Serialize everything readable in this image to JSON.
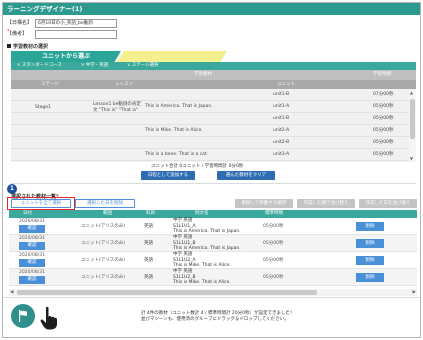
{
  "window": {
    "title": "ラーニングデザイナー(1)"
  },
  "form": {
    "title_label": "【日構名】",
    "title_req": "*",
    "title_value": "6月10日の小_英語_be動詞",
    "memo_label": "【備考】",
    "memo_value": ""
  },
  "section_title": "学習教材の選択",
  "tabs": {
    "active": "ユニットから選ぶ",
    "inactive": ""
  },
  "filters": {
    "course": "∨ スタンダードコース",
    "level": "∨ 中学・英語",
    "stage": "∨ ステージ選択"
  },
  "upper_table": {
    "header_group": "学習教材",
    "header_time": "学習時間",
    "col_stage": "ステージ",
    "col_lesson": "レッスン",
    "col_unit": "ユニット",
    "stage_value": "Stage1",
    "lesson_value": "Lesson1 be動詞の肯定文 \"This is\" \"That is\"",
    "rows": [
      {
        "example": "",
        "unit": "unit1-B",
        "time": "07分00秒"
      },
      {
        "example": "This is America. That is Japan.",
        "unit": "unit1-A",
        "time": "05分00秒"
      },
      {
        "example": "",
        "unit": "unit1-B",
        "time": "05分00秒"
      },
      {
        "example": "This is Mike. That is Alice.",
        "unit": "unit2-A",
        "time": "05分00秒"
      },
      {
        "example": "",
        "unit": "unit2-B",
        "time": "05分00秒"
      },
      {
        "example": "This is a bone. That is a cat.",
        "unit": "unit3-A",
        "time": "05分00秒"
      }
    ]
  },
  "totals_text": "ユニット合計 0ユニット / 学習時間計 0分0秒",
  "buttons": {
    "add_to_lesson": "日程として追加する",
    "clear_selection": "選んだ教材をクリア",
    "select_all": "ユニットを全て選択",
    "delete_selected": "選択した日を削除",
    "order_top": "削除して移動する順序",
    "move_up": "作成した順で並び替え",
    "move_down": "作成した日を並び替え"
  },
  "step_badge": "1",
  "list": {
    "title": "選択された教材一覧",
    "title_req": "*",
    "headers": {
      "date": "日付",
      "unit": "範囲",
      "subject": "科目",
      "example": "例文名",
      "time": "標準時間",
      "action": ""
    },
    "rows": [
      {
        "date": "2020/08/31",
        "btn": "確認",
        "unit": "ユニット(アリスのみ)",
        "subject": "英語",
        "ex_line1": "中学 英語",
        "ex_line2": "S1L1U1_A",
        "ex_line3": "This is America. That is Japan.",
        "time": "05分00秒",
        "del": "削除"
      },
      {
        "date": "2020/08/31",
        "btn": "確認",
        "unit": "ユニット(アリスのみ)",
        "subject": "英語",
        "ex_line1": "中学 英語",
        "ex_line2": "S1L1U1_B",
        "ex_line3": "This is America. That is Japan.",
        "time": "05分00秒",
        "del": "削除"
      },
      {
        "date": "2020/08/31",
        "btn": "確認",
        "unit": "ユニット(アリスのみ)",
        "subject": "英語",
        "ex_line1": "中学 英語",
        "ex_line2": "S1L1U2_A",
        "ex_line3": "This is Mike. That is Alice.",
        "time": "05分00秒",
        "del": "削除"
      },
      {
        "date": "2020/08/31",
        "btn": "確認",
        "unit": "ユニット(アリスのみ)",
        "subject": "英語",
        "ex_line1": "中学 英語",
        "ex_line2": "S1L1U2_B",
        "ex_line3": "This is Mike. That is Alice.",
        "time": "05分00秒",
        "del": "削除"
      }
    ]
  },
  "footer": {
    "line1": "計 4件の教材（ユニット数計 4 / 標準時間計 20分0秒）が設定できました！",
    "line2": "並びマシーンも、使用済のグループにドラッグ＆ドロップしてください。"
  },
  "icons": {
    "flag": "flag-icon",
    "hand": "pointer-hand-icon",
    "scroll_up": "up-arrow-icon",
    "scroll_down": "down-arrow-icon"
  },
  "colors": {
    "teal": "#2d9a90",
    "accent_blue": "#4a90d9",
    "highlight_red": "#e2262a",
    "badge_navy": "#1d4f9a",
    "tab_yellow": "#f4ef8f"
  }
}
